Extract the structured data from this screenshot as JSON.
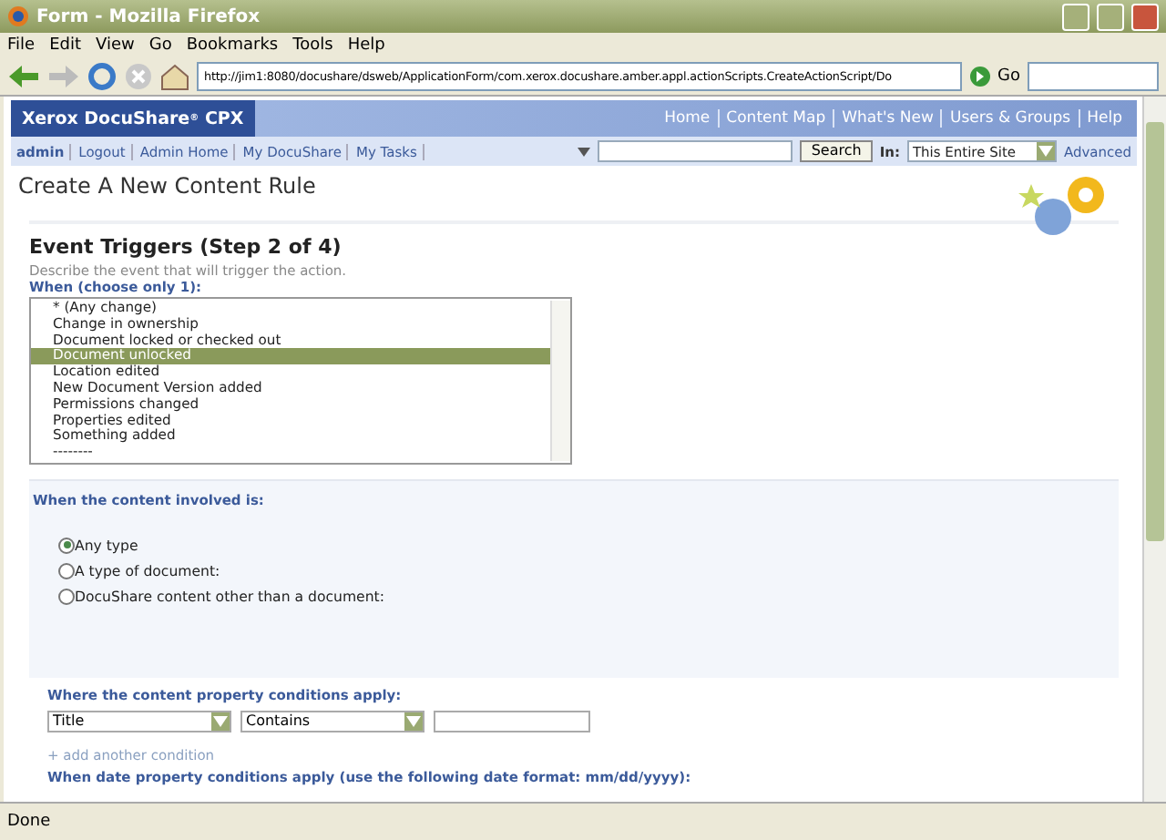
{
  "window": {
    "title": "Form - Mozilla Firefox"
  },
  "menu": [
    "File",
    "Edit",
    "View",
    "Go",
    "Bookmarks",
    "Tools",
    "Help"
  ],
  "address": {
    "value": "http://jim1:8080/docushare/dsweb/ApplicationForm/com.xerox.docushare.amber.appl.actionScripts.CreateActionScript/Do",
    "go": "Go"
  },
  "site": {
    "logo": "Xerox DocuShare",
    "logo_mark": "®",
    "logo_suffix": "CPX",
    "nav": [
      "Home",
      "Content Map",
      "What's New",
      "Users & Groups",
      "Help"
    ]
  },
  "user_bar": {
    "links": [
      "admin",
      "Logout",
      "Admin Home",
      "My DocuShare",
      "My Tasks"
    ],
    "search_button": "Search",
    "in_label": "In:",
    "scope": "This Entire Site",
    "advanced": "Advanced"
  },
  "page_title": "Create A New Content Rule",
  "event_triggers": {
    "heading": "Event Triggers (Step 2 of 4)",
    "description": "Describe the event that will trigger the action.",
    "when_label": "When (choose only 1):",
    "options": [
      {
        "label": "* (Any change)",
        "selected": false
      },
      {
        "label": "Change in ownership",
        "selected": false
      },
      {
        "label": "Document locked or checked out",
        "selected": false
      },
      {
        "label": "Document unlocked",
        "selected": true
      },
      {
        "label": "Location edited",
        "selected": false
      },
      {
        "label": "New Document Version added",
        "selected": false
      },
      {
        "label": "Permissions changed",
        "selected": false
      },
      {
        "label": "Properties edited",
        "selected": false
      },
      {
        "label": "Something added",
        "selected": false
      },
      {
        "label": "--------",
        "selected": false
      }
    ]
  },
  "content_involved": {
    "heading": "When the content involved is:",
    "options": [
      {
        "label": "Any type",
        "selected": true
      },
      {
        "label": "A type of document:",
        "selected": false
      },
      {
        "label": "DocuShare content other than a document:",
        "selected": false
      }
    ]
  },
  "conditions": {
    "heading": "Where the content property conditions apply:",
    "property": "Title",
    "operator": "Contains",
    "add_link": "+ add another condition",
    "date_heading": "When date property conditions apply (use the following date format: mm/dd/yyyy):"
  },
  "status_bar": {
    "text": "Done"
  }
}
